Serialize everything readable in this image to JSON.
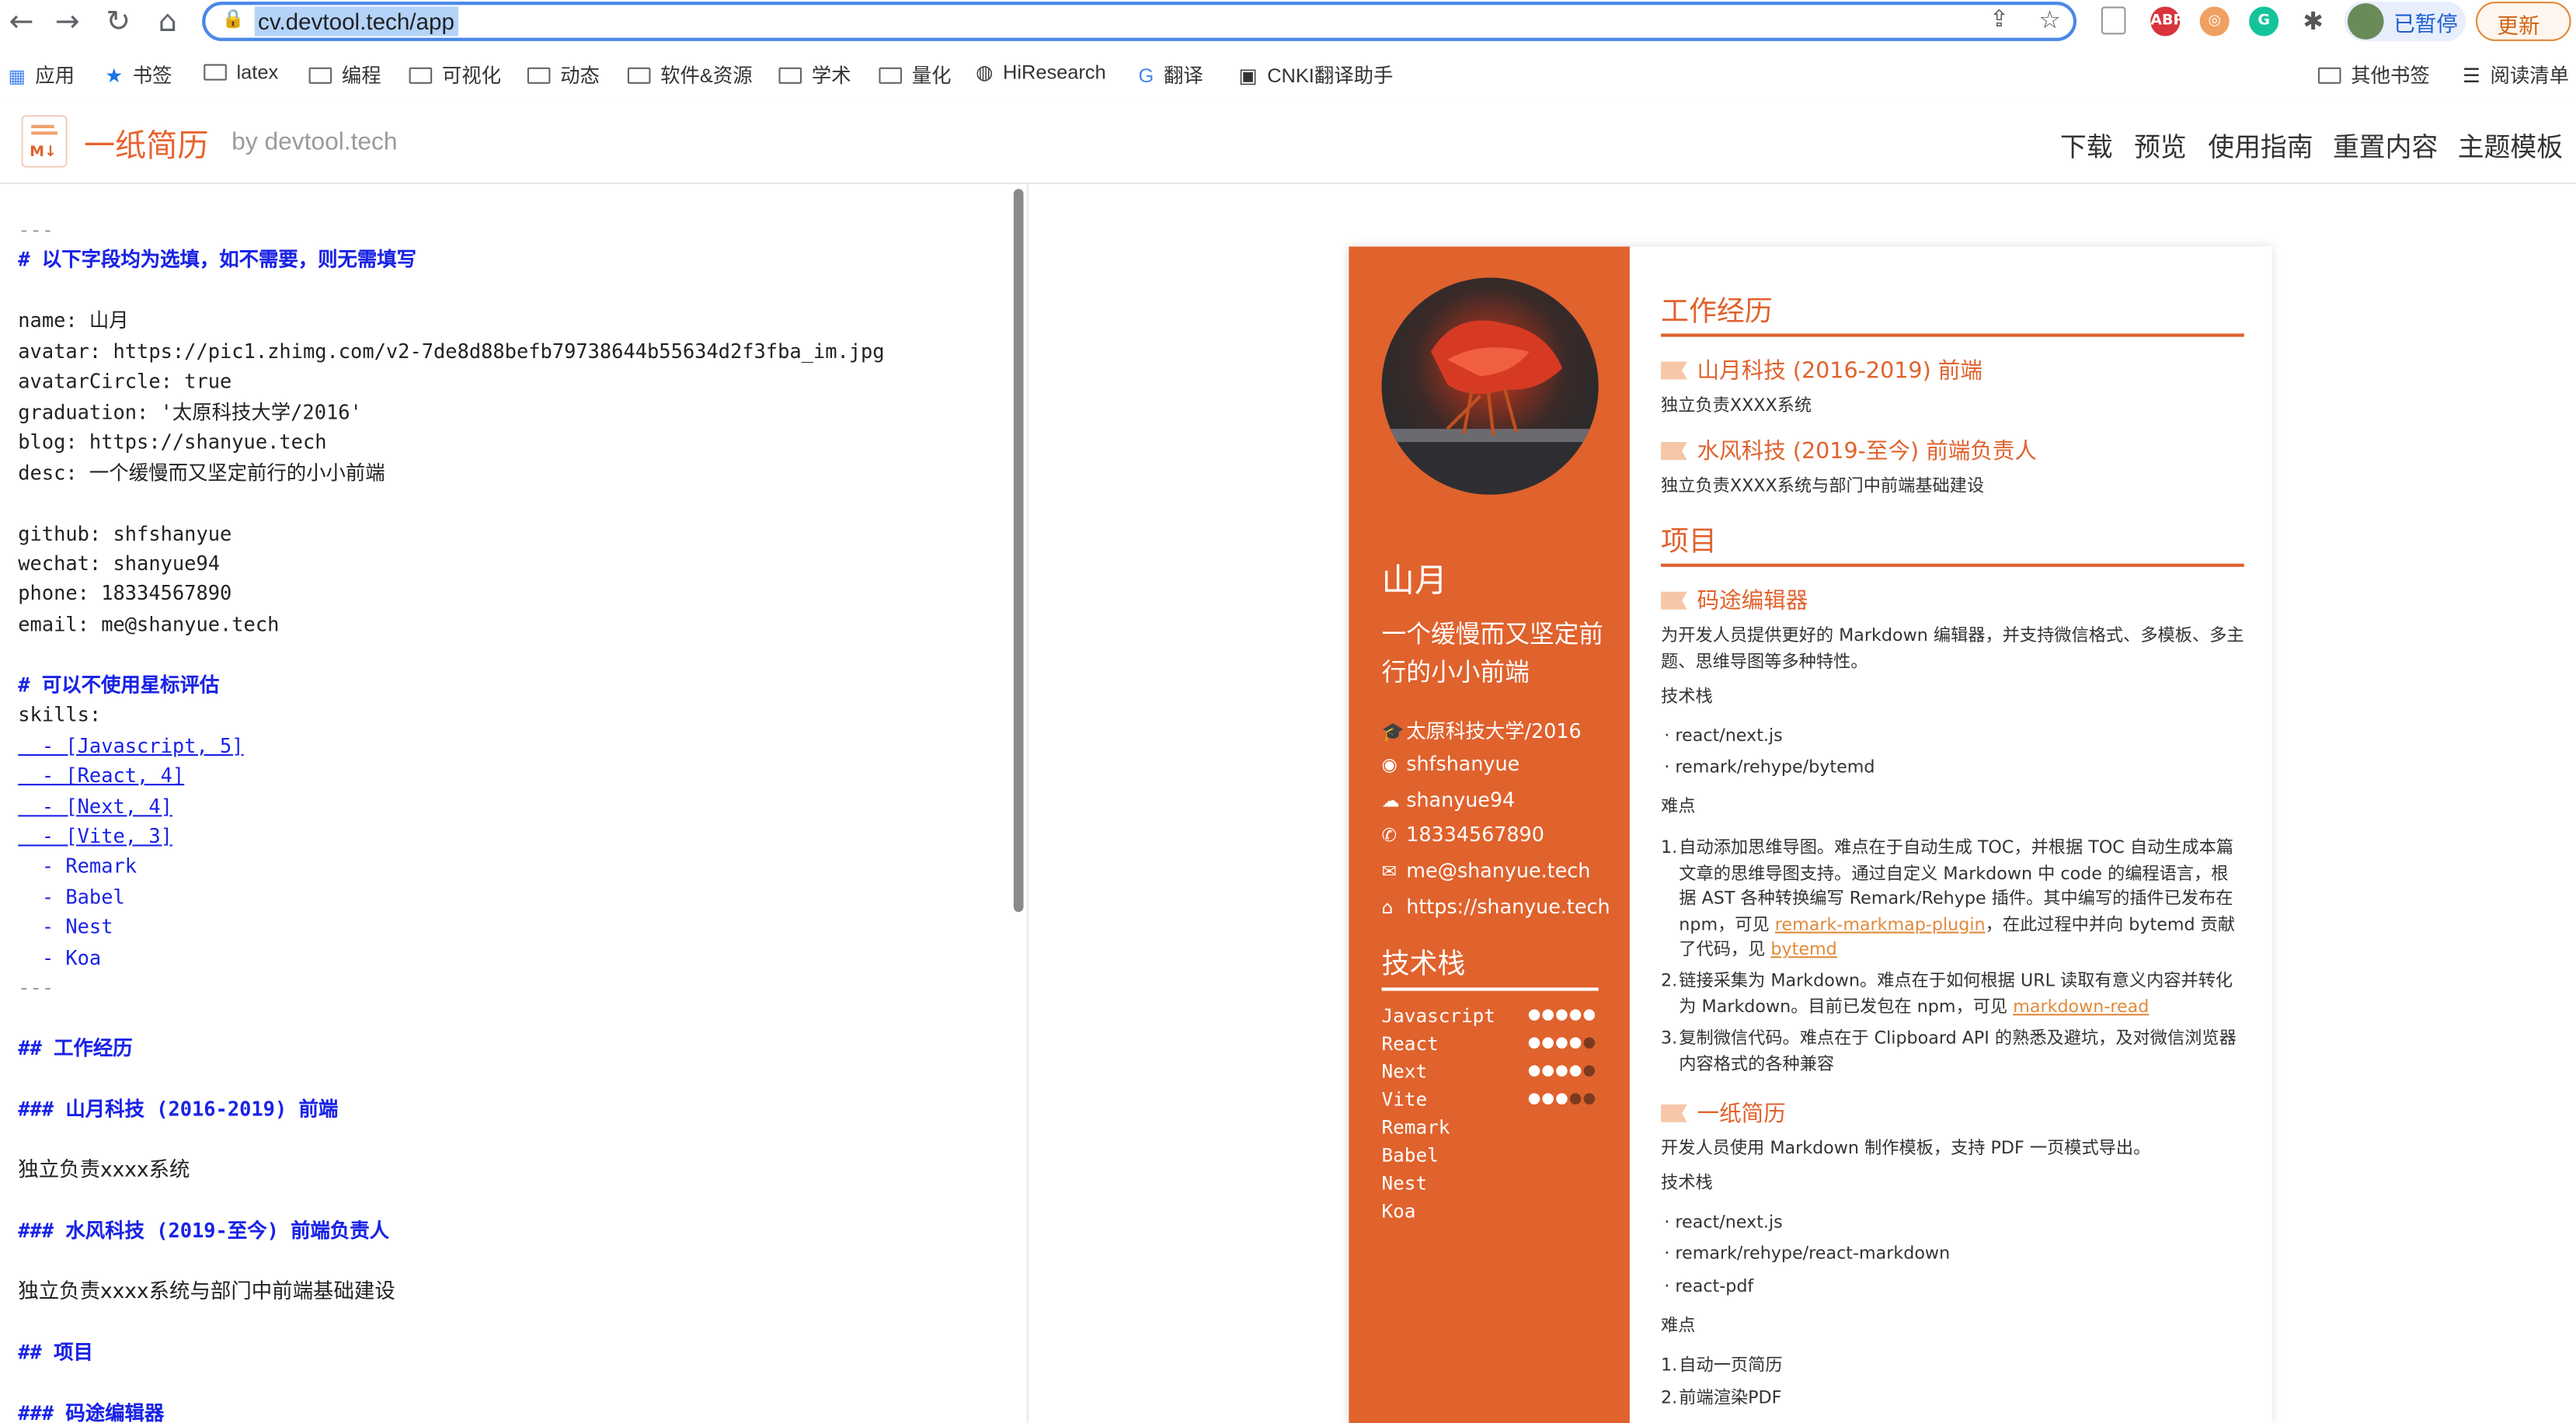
{
  "browser": {
    "url": "cv.devtool.tech/app",
    "pause_label": "已暂停",
    "update_label": "更新",
    "bookmarks": [
      "应用",
      "书签",
      "latex",
      "编程",
      "可视化",
      "动态",
      "软件&资源",
      "学术",
      "量化",
      "HiResearch",
      "翻译",
      "CNKI翻译助手"
    ],
    "other_bookmarks": "其他书签",
    "reading_list": "阅读清单",
    "ext_abp": "ABP",
    "ext_g": "G"
  },
  "app": {
    "brand": "一纸简历",
    "by": "by devtool.tech",
    "logo_mark": "M↓",
    "nav": [
      "下载",
      "预览",
      "使用指南",
      "重置内容",
      "主题模板"
    ]
  },
  "editor": {
    "lines": [
      {
        "cls": "cm",
        "text": "---"
      },
      {
        "cls": "hdm",
        "text": "# 以下字段均为选填，如不需要，则无需填写"
      },
      {
        "cls": "",
        "text": ""
      },
      {
        "cls": "",
        "text": "name: 山月"
      },
      {
        "cls": "",
        "text": "avatar: https://pic1.zhimg.com/v2-7de8d88befb79738644b55634d2f3fba_im.jpg"
      },
      {
        "cls": "",
        "text": "avatarCircle: true"
      },
      {
        "cls": "",
        "text": "graduation: '太原科技大学/2016'"
      },
      {
        "cls": "",
        "text": "blog: https://shanyue.tech"
      },
      {
        "cls": "",
        "text": "desc: 一个缓慢而又坚定前行的小小前端"
      },
      {
        "cls": "",
        "text": ""
      },
      {
        "cls": "",
        "text": "github: shfshanyue"
      },
      {
        "cls": "",
        "text": "wechat: shanyue94"
      },
      {
        "cls": "",
        "text": "phone: 18334567890"
      },
      {
        "cls": "",
        "text": "email: me@shanyue.tech"
      },
      {
        "cls": "",
        "text": ""
      },
      {
        "cls": "hdm",
        "text": "# 可以不使用星标评估"
      },
      {
        "cls": "",
        "text": "skills:"
      },
      {
        "cls": "lk",
        "text": "  - [Javascript, 5]"
      },
      {
        "cls": "lk",
        "text": "  - [React, 4]"
      },
      {
        "cls": "lk",
        "text": "  - [Next, 4]"
      },
      {
        "cls": "lk",
        "text": "  - [Vite, 3]"
      },
      {
        "cls": "li",
        "text": "  - Remark"
      },
      {
        "cls": "li",
        "text": "  - Babel"
      },
      {
        "cls": "li",
        "text": "  - Nest"
      },
      {
        "cls": "li",
        "text": "  - Koa"
      },
      {
        "cls": "cm",
        "text": "---"
      },
      {
        "cls": "",
        "text": ""
      },
      {
        "cls": "hdm",
        "text": "## 工作经历"
      },
      {
        "cls": "",
        "text": ""
      },
      {
        "cls": "hdm",
        "text": "### 山月科技 (2016-2019) 前端"
      },
      {
        "cls": "",
        "text": ""
      },
      {
        "cls": "tx",
        "text": "独立负责xxxx系统"
      },
      {
        "cls": "",
        "text": ""
      },
      {
        "cls": "hdm",
        "text": "### 水风科技 (2019-至今) 前端负责人"
      },
      {
        "cls": "",
        "text": ""
      },
      {
        "cls": "tx",
        "text": "独立负责xxxx系统与部门中前端基础建设"
      },
      {
        "cls": "",
        "text": ""
      },
      {
        "cls": "hdm",
        "text": "## 项目"
      },
      {
        "cls": "",
        "text": ""
      },
      {
        "cls": "hdm",
        "text": "### 码途编辑器"
      }
    ]
  },
  "resume": {
    "name": "山月",
    "desc": "一个缓慢而又坚定前行的小小前端",
    "contacts": [
      {
        "icon": "graduation-cap-icon",
        "glyph": "🎓",
        "text": "太原科技大学/2016"
      },
      {
        "icon": "github-icon",
        "glyph": "◉",
        "text": "shfshanyue"
      },
      {
        "icon": "wechat-icon",
        "glyph": "☁",
        "text": "shanyue94"
      },
      {
        "icon": "phone-icon",
        "glyph": "✆",
        "text": "18334567890"
      },
      {
        "icon": "mail-icon",
        "glyph": "✉",
        "text": "me@shanyue.tech"
      },
      {
        "icon": "home-icon",
        "glyph": "⌂",
        "text": "https://shanyue.tech"
      }
    ],
    "skills_title": "技术栈",
    "skills": [
      {
        "name": "Javascript",
        "level": 5
      },
      {
        "name": "React",
        "level": 4
      },
      {
        "name": "Next",
        "level": 4
      },
      {
        "name": "Vite",
        "level": 3
      },
      {
        "name": "Remark",
        "level": null
      },
      {
        "name": "Babel",
        "level": null
      },
      {
        "name": "Nest",
        "level": null
      },
      {
        "name": "Koa",
        "level": null
      }
    ],
    "work_title": "工作经历",
    "job1_title": "山月科技 (2016-2019) 前端",
    "job1_desc": "独立负责XXXX系统",
    "job2_title": "水风科技 (2019-至今) 前端负责人",
    "job2_desc": "独立负责XXXX系统与部门中前端基础建设",
    "project_title": "项目",
    "proj1_title": "码途编辑器",
    "proj1_desc": "为开发人员提供更好的 Markdown 编辑器，并支持微信格式、多模板、多主题、思维导图等多种特性。",
    "stack_label": "技术栈",
    "proj1_stack": [
      "react/next.js",
      "remark/rehype/bytemd"
    ],
    "difficulty_label": "难点",
    "proj1_d1_a": "自动添加思维导图。难点在于自动生成 TOC，并根据 TOC 自动生成本篇文章的思维导图支持。通过自定义 Markdown 中 code 的编程语言，根据 AST 各种转换编写 Remark/Rehype 插件。其中编写的插件已发布在 npm，可见 ",
    "proj1_d1_link1": "remark-markmap-plugin",
    "proj1_d1_b": "，在此过程中并向 bytemd 贡献了代码，见 ",
    "proj1_d1_link2": "bytemd",
    "proj1_d2_a": "链接采集为 Markdown。难点在于如何根据 URL 读取有意义内容并转化为 Markdown。目前已发包在 npm，可见 ",
    "proj1_d2_link": "markdown-read",
    "proj1_d3": "复制微信代码。难点在于 Clipboard API 的熟悉及避坑，及对微信浏览器内容格式的各种兼容",
    "proj2_title": "一纸简历",
    "proj2_desc": "开发人员使用 Markdown 制作模板，支持 PDF 一页模式导出。",
    "proj2_stack": [
      "react/next.js",
      "remark/rehype/react-markdown",
      "react-pdf"
    ],
    "proj2_d1": "自动一页简历",
    "proj2_d2": "前端渲染PDF"
  },
  "colors": {
    "accent": "#e0622d",
    "editor_heading": "#1a23e6",
    "link": "#e08a3a"
  }
}
